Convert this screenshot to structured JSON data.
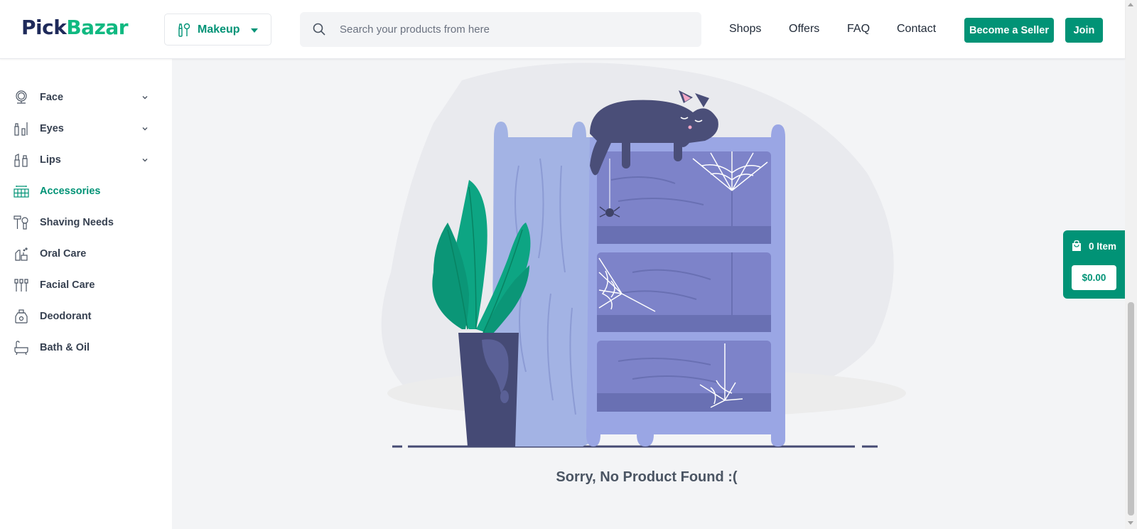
{
  "brand": {
    "part1": "Pick",
    "part2": "Bazar"
  },
  "category_select": {
    "value": "Makeup",
    "icon": "makeup-brush-icon"
  },
  "search": {
    "placeholder": "Search your products from here"
  },
  "nav": [
    "Shops",
    "Offers",
    "FAQ",
    "Contact"
  ],
  "buttons": {
    "seller": "Become a Seller",
    "join": "Join"
  },
  "sidebar": {
    "items": [
      {
        "label": "Face",
        "icon": "face-mirror-icon",
        "expandable": true
      },
      {
        "label": "Eyes",
        "icon": "eyes-makeup-icon",
        "expandable": true
      },
      {
        "label": "Lips",
        "icon": "lipstick-icon",
        "expandable": true
      },
      {
        "label": "Accessories",
        "icon": "palette-icon",
        "expandable": false,
        "active": true
      },
      {
        "label": "Shaving Needs",
        "icon": "razor-icon",
        "expandable": false
      },
      {
        "label": "Oral Care",
        "icon": "toothbrush-icon",
        "expandable": false
      },
      {
        "label": "Facial Care",
        "icon": "facial-brushes-icon",
        "expandable": false
      },
      {
        "label": "Deodorant",
        "icon": "deodorant-bottle-icon",
        "expandable": false
      },
      {
        "label": "Bath & Oil",
        "icon": "bathtub-icon",
        "expandable": false
      }
    ]
  },
  "empty_state": {
    "message": "Sorry, No Product Found :("
  },
  "cart": {
    "items": "0 Item",
    "total": "$0.00",
    "icon": "shopping-bag-icon"
  },
  "colors": {
    "accent": "#019376",
    "brand_dark": "#1e2a5a",
    "brand_green": "#10b981",
    "shelf": "#8b93d9",
    "plant": "#0d9f7a"
  }
}
